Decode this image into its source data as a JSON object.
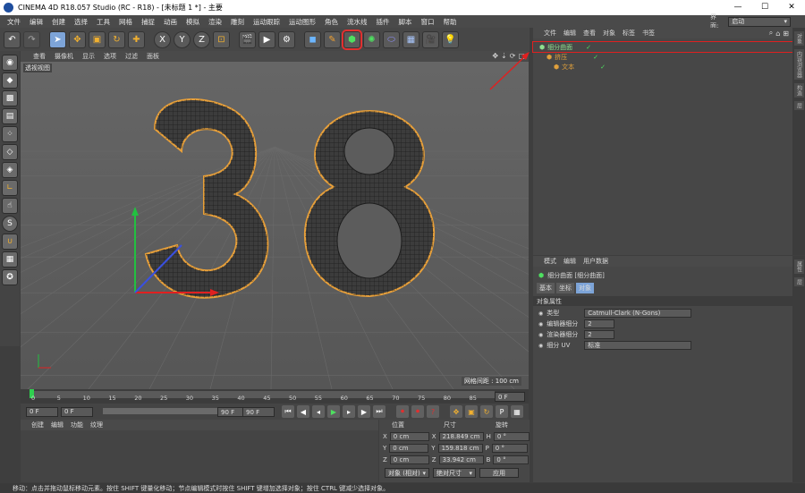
{
  "window": {
    "title": "CINEMA 4D R18.057 Studio (RC - R18) - [未标题 1 *] - 主要",
    "controls": [
      "—",
      "☐",
      "✕"
    ]
  },
  "menu": [
    "文件",
    "编辑",
    "创建",
    "选择",
    "工具",
    "网格",
    "捕捉",
    "动画",
    "模拟",
    "渲染",
    "雕刻",
    "运动跟踪",
    "运动图形",
    "角色",
    "流水线",
    "插件",
    "脚本",
    "窗口",
    "帮助"
  ],
  "layout": {
    "label": "界面:",
    "value": "启动"
  },
  "toolbar": {
    "icons": [
      "undo-icon",
      "redo-icon",
      "select-icon",
      "move-icon",
      "scale-icon",
      "rotate-icon",
      "add-icon",
      "x-axis-icon",
      "y-axis-icon",
      "z-axis-icon",
      "coord-icon",
      "render-view-icon",
      "render-icon",
      "render-settings-icon",
      "cube-icon",
      "pen-icon",
      "subdivision-icon",
      "array-icon",
      "deformer-icon",
      "floor-icon",
      "camera-icon",
      "light-icon"
    ],
    "x": "X",
    "y": "Y",
    "z": "Z"
  },
  "viewport": {
    "menu": [
      "查看",
      "摄像机",
      "显示",
      "选项",
      "过滤",
      "面板"
    ],
    "label": "透视视图",
    "digits": "38",
    "grid": "网格间距 : 100 cm"
  },
  "timeline": {
    "ticks": [
      "0",
      "5",
      "10",
      "15",
      "20",
      "25",
      "30",
      "35",
      "40",
      "45",
      "50",
      "55",
      "60",
      "65",
      "70",
      "75",
      "80",
      "85",
      "90"
    ],
    "end": "0 F"
  },
  "anim": {
    "start": "0 F",
    "cur": "0 F",
    "end": "90 F",
    "end2": "90 F"
  },
  "materials": {
    "menu": [
      "创建",
      "编辑",
      "功能",
      "纹理"
    ]
  },
  "coords": {
    "headers": [
      "位置",
      "尺寸",
      "旋转"
    ],
    "rows": [
      {
        "axis": "X",
        "pos": "0 cm",
        "size": "218.849 cm",
        "rl": "H",
        "rot": "0 °"
      },
      {
        "axis": "Y",
        "pos": "0 cm",
        "size": "159.818 cm",
        "rl": "P",
        "rot": "0 °"
      },
      {
        "axis": "Z",
        "pos": "0 cm",
        "size": "33.942 cm",
        "rl": "B",
        "rot": "0 °"
      }
    ],
    "mode": "对象 (相对)",
    "sizemode": "绝对尺寸",
    "apply": "应用"
  },
  "objects": {
    "menu": [
      "文件",
      "编辑",
      "查看",
      "对象",
      "标签",
      "书签"
    ],
    "items": [
      {
        "name": "细分曲面",
        "indent": 0,
        "color": "#8fe08f"
      },
      {
        "name": "挤压",
        "indent": 1,
        "color": "#e0a03c"
      },
      {
        "name": "文本",
        "indent": 2,
        "color": "#e0a03c"
      }
    ]
  },
  "sidetabs": [
    "对象",
    "内容浏览器",
    "构造",
    "层"
  ],
  "attrs": {
    "menu": [
      "模式",
      "编辑",
      "用户数据"
    ],
    "title": "细分曲面 [细分曲面]",
    "tabs": [
      "基本",
      "坐标",
      "对象"
    ],
    "section": "对象属性",
    "rows": [
      {
        "label": "类型",
        "value": "Catmull-Clark (N-Gons)"
      },
      {
        "label": "编辑器细分",
        "value": "2"
      },
      {
        "label": "渲染器细分",
        "value": "2"
      },
      {
        "label": "细分 UV",
        "value": "标准"
      }
    ]
  },
  "attr_sidetabs": [
    "属性",
    "层"
  ],
  "status": "移动：点击并拖动鼠标移动元素。按住 SHIFT 键量化移动；节点编辑模式时按住 SHIFT 键增加选择对象；按住 CTRL 键减少选择对象。",
  "colors": {
    "selection_outline": "#e23030",
    "spline_highlight": "#e8a03a",
    "green_axis": "#22c040",
    "red_axis": "#e02020",
    "blue_axis": "#3a50e0"
  }
}
